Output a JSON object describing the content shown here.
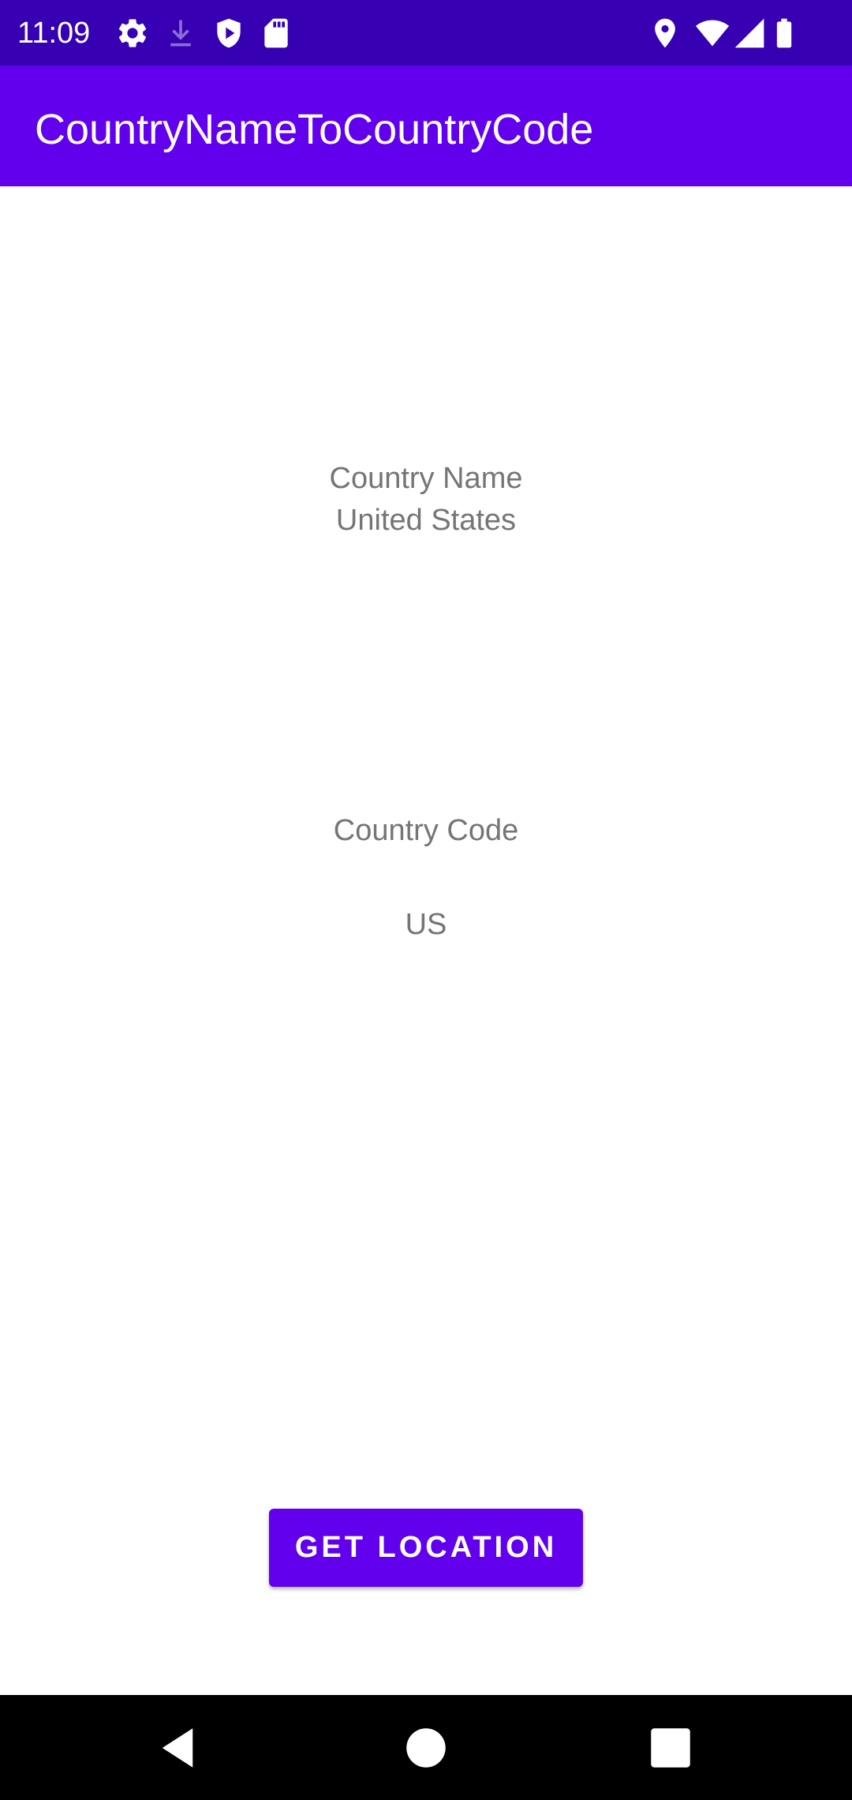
{
  "status_bar": {
    "time": "11:09",
    "left_icons": [
      "gear-icon",
      "download-icon",
      "shield-play-icon",
      "sd-card-icon"
    ],
    "right_icons": [
      "location-pin-icon",
      "wifi-icon",
      "cell-signal-icon",
      "battery-icon"
    ]
  },
  "app_bar": {
    "title": "CountryNameToCountryCode"
  },
  "main": {
    "country_name_label": "Country Name",
    "country_name_value": "United States",
    "country_code_label": "Country Code",
    "country_code_value": "US",
    "get_location_button": "GET LOCATION"
  },
  "nav_bar": {
    "buttons": [
      "back-icon",
      "home-icon",
      "recents-icon"
    ]
  },
  "colors": {
    "status_bar": "#3700B3",
    "primary": "#6200EE",
    "text_secondary": "#757575"
  }
}
